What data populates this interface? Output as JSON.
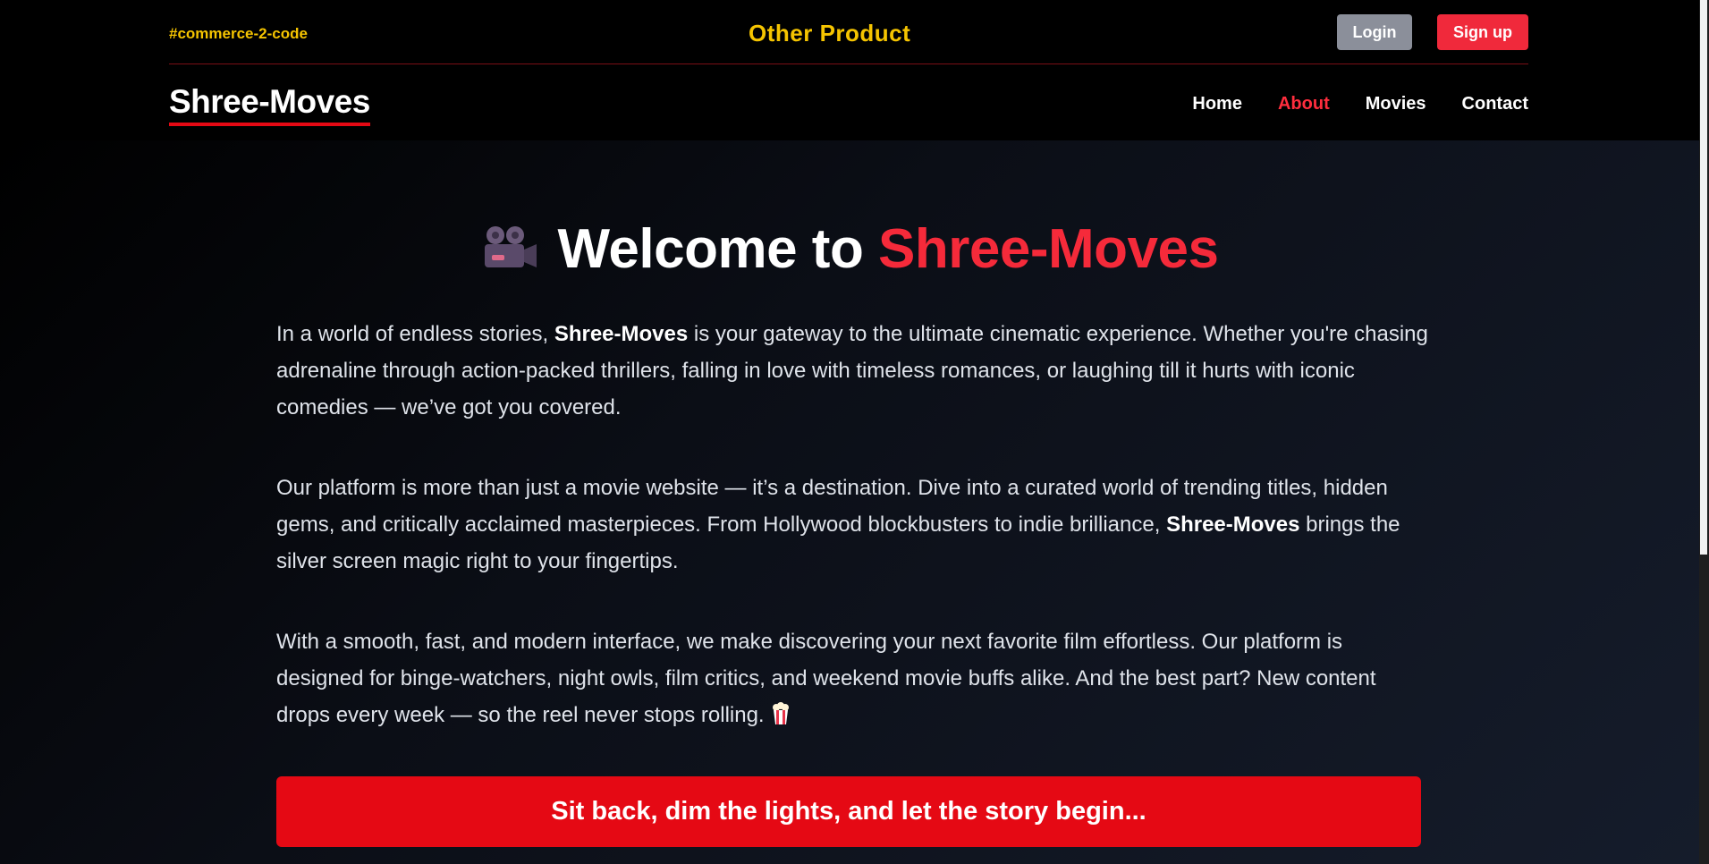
{
  "topbar": {
    "tag": "#commerce-2-code",
    "other_product": "Other Product",
    "login_label": "Login",
    "signup_label": "Sign up"
  },
  "brand": {
    "logo": "Shree-Moves"
  },
  "nav": {
    "items": [
      {
        "label": "Home",
        "active": false
      },
      {
        "label": "About",
        "active": true
      },
      {
        "label": "Movies",
        "active": false
      },
      {
        "label": "Contact",
        "active": false
      }
    ]
  },
  "hero": {
    "welcome_prefix": "Welcome to",
    "welcome_brand": "Shree-Moves",
    "icon": "movie-camera-icon"
  },
  "paragraphs": {
    "p1_before": "In a world of endless stories, ",
    "p1_bold": "Shree-Moves",
    "p1_after": " is your gateway to the ultimate cinematic experience. Whether you're chasing adrenaline through action-packed thrillers, falling in love with timeless romances, or laughing till it hurts with iconic comedies — we’ve got you covered.",
    "p2_before": "Our platform is more than just a movie website — it’s a destination. Dive into a curated world of trending titles, hidden gems, and critically acclaimed masterpieces. From Hollywood blockbusters to indie brilliance, ",
    "p2_bold": "Shree-Moves",
    "p2_after": " brings the silver screen magic right to your fingertips.",
    "p3": "With a smooth, fast, and modern interface, we make discovering your next favorite film effortless. Our platform is designed for binge-watchers, night owls, film critics, and weekend movie buffs alike. And the best part? New content drops every week — so the reel never stops rolling."
  },
  "cta": {
    "text": "Sit back, dim the lights, and let the story begin..."
  },
  "colors": {
    "accent_red": "#e50914",
    "brand_red": "#f52a3a",
    "tag_yellow": "#f5c400",
    "login_gray": "#8b8f9a"
  }
}
